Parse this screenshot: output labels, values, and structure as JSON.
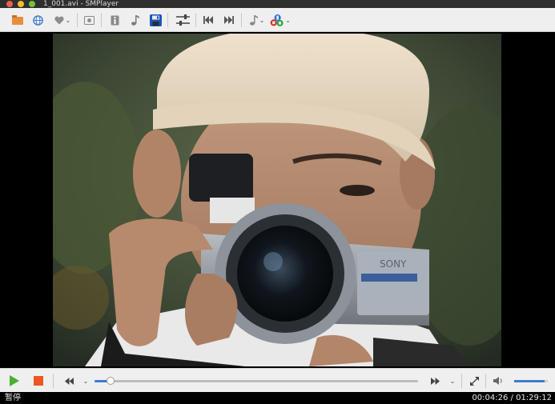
{
  "window": {
    "title": "1_001.avi - SMPlayer"
  },
  "status": {
    "state": "暂停",
    "position": "00:04:26",
    "separator": " / ",
    "duration": "01:29:12"
  },
  "playback": {
    "progress": 0.05,
    "volume": 0.9
  },
  "toolbar": {
    "icons": [
      "open-folder-icon",
      "web-icon",
      "favorites-icon",
      "screenshot-icon",
      "info-icon",
      "audio-track-icon",
      "save-icon",
      "preferences-icon",
      "previous-icon",
      "next-icon",
      "audio-menu-icon",
      "subtitles-icon"
    ]
  },
  "controls": {
    "icons": [
      "play-icon",
      "stop-icon",
      "rewind-icon",
      "forward-icon",
      "fullscreen-icon",
      "volume-icon"
    ]
  },
  "colors": {
    "accent": "#3d7bd0",
    "play": "#4caf2e",
    "stop": "#ee5522"
  }
}
